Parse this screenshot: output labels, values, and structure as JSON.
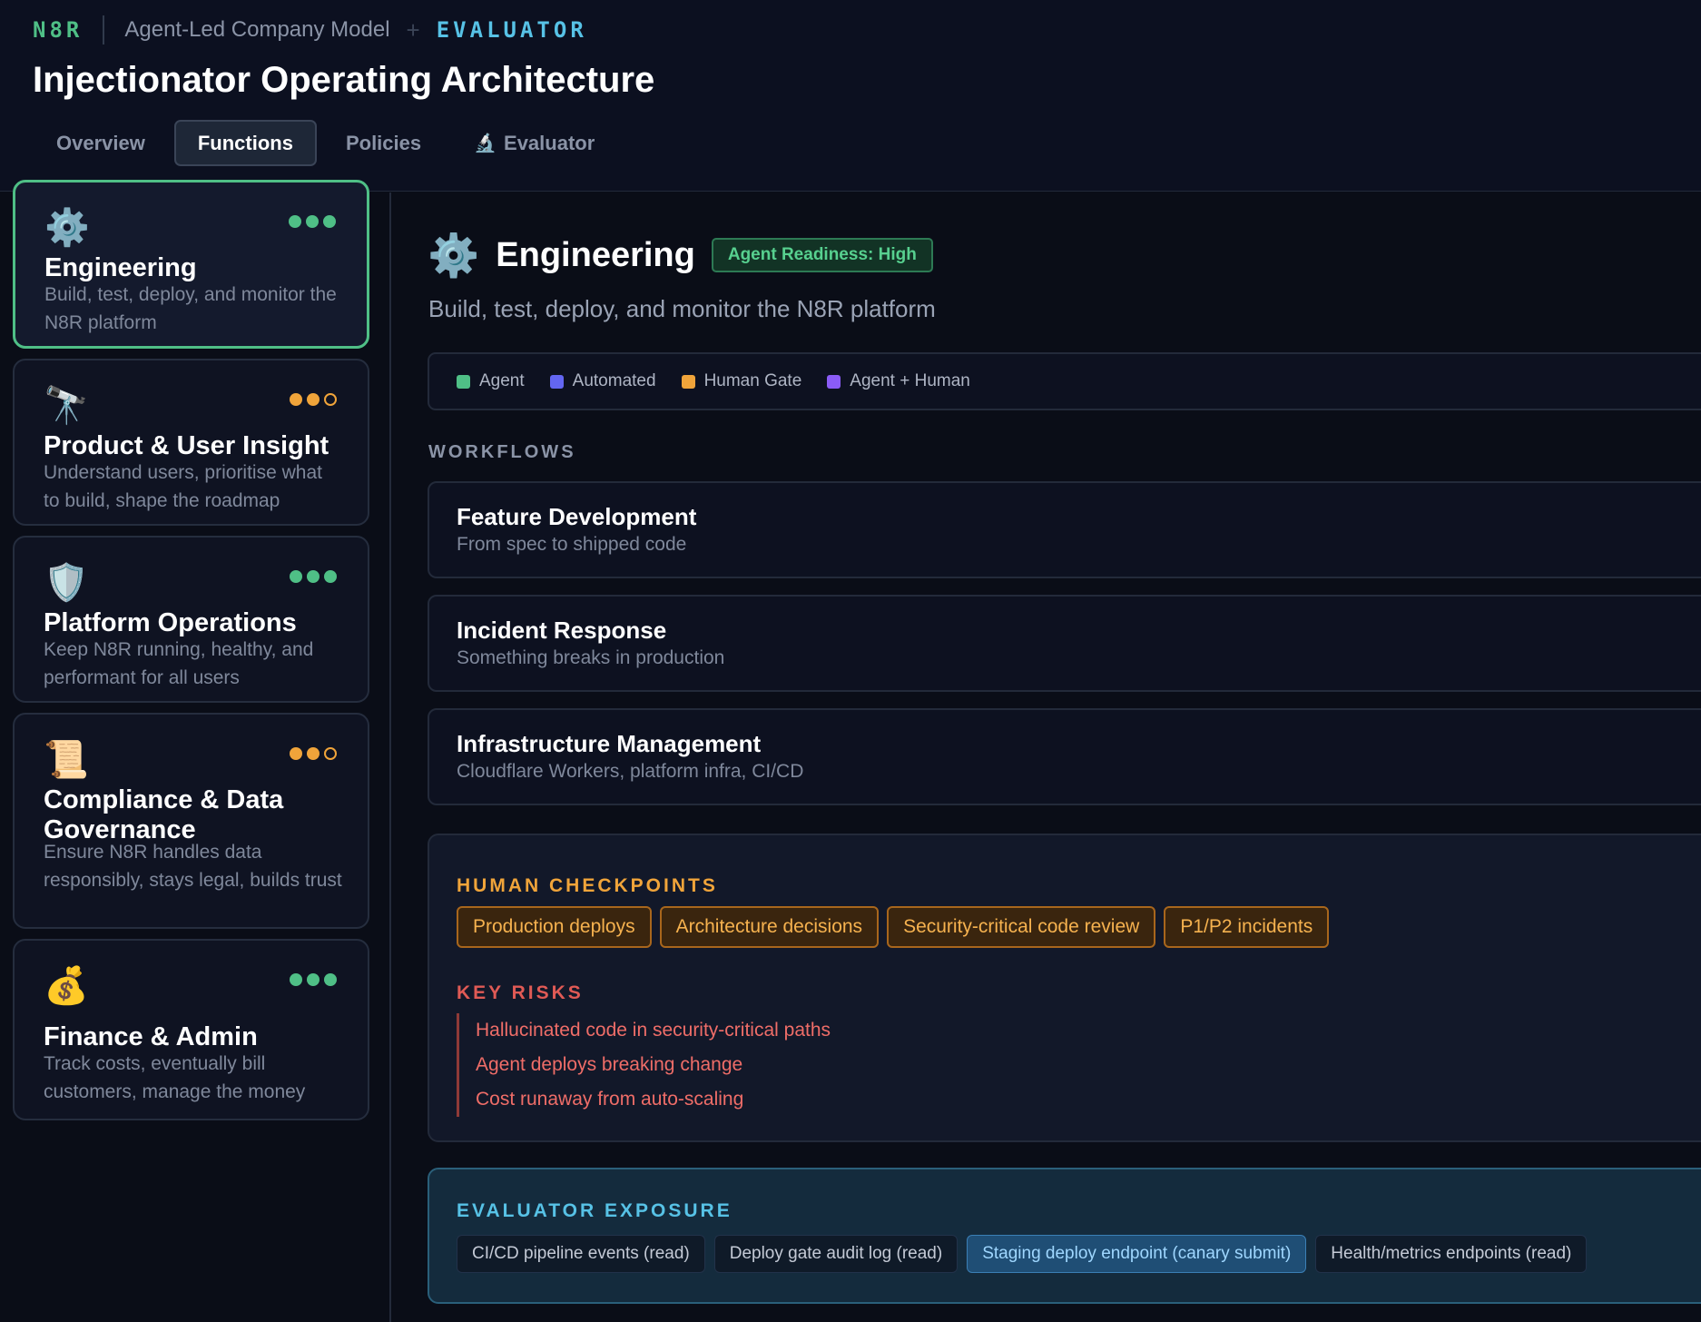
{
  "header": {
    "brand": "N8R",
    "breadcrumb": "Agent-Led Company Model",
    "separator": "+",
    "evaluator_tag": "EVALUATOR",
    "title": "Injectionator Operating Architecture",
    "tabs": [
      {
        "label": "Overview",
        "active": false
      },
      {
        "label": "Functions",
        "active": true
      },
      {
        "label": "Policies",
        "active": false
      },
      {
        "label": "Evaluator",
        "icon": "microscope-icon",
        "active": false
      }
    ]
  },
  "sidebar": {
    "functions": [
      {
        "icon": "gear-icon",
        "glyph": "⚙️",
        "name": "Engineering",
        "desc": "Build, test, deploy, and monitor the N8R platform",
        "readiness_dots": [
          "green",
          "green",
          "green"
        ],
        "active": true
      },
      {
        "icon": "telescope-icon",
        "glyph": "🔭",
        "name": "Product & User Insight",
        "desc": "Understand users, prioritise what to build, shape the roadmap",
        "readiness_dots": [
          "orange",
          "orange",
          "orange-empty"
        ],
        "active": false
      },
      {
        "icon": "shield-icon",
        "glyph": "🛡️",
        "name": "Platform Operations",
        "desc": "Keep N8R running, healthy, and performant for all users",
        "readiness_dots": [
          "green",
          "green",
          "green"
        ],
        "active": false
      },
      {
        "icon": "scroll-icon",
        "glyph": "📜",
        "name": "Compliance & Data Governance",
        "desc": "Ensure N8R handles data responsibly, stays legal, builds trust",
        "readiness_dots": [
          "orange",
          "orange",
          "orange-empty"
        ],
        "active": false
      },
      {
        "icon": "money-bag-icon",
        "glyph": "💰",
        "name": "Finance & Admin",
        "desc": "Track costs, eventually bill customers, manage the money",
        "readiness_dots": [
          "green",
          "green",
          "green"
        ],
        "active": false
      }
    ]
  },
  "main": {
    "icon": "gear-icon",
    "glyph": "⚙️",
    "title": "Engineering",
    "readiness_badge": "Agent Readiness: High",
    "description": "Build, test, deploy, and monitor the N8R platform",
    "legend": [
      {
        "label": "Agent",
        "color": "#4fbf86"
      },
      {
        "label": "Automated",
        "color": "#6366f1"
      },
      {
        "label": "Human Gate",
        "color": "#f0a43a"
      },
      {
        "label": "Agent + Human",
        "color": "#8b5cf6"
      }
    ],
    "workflows_label": "WORKFLOWS",
    "workflows": [
      {
        "title": "Feature Development",
        "subtitle": "From spec to shipped code"
      },
      {
        "title": "Incident Response",
        "subtitle": "Something breaks in production"
      },
      {
        "title": "Infrastructure Management",
        "subtitle": "Cloudflare Workers, platform infra, CI/CD"
      }
    ],
    "human_checkpoints_label": "HUMAN CHECKPOINTS",
    "human_checkpoints": [
      "Production deploys",
      "Architecture decisions",
      "Security-critical code review",
      "P1/P2 incidents"
    ],
    "key_risks_label": "KEY RISKS",
    "key_risks": [
      "Hallucinated code in security-critical paths",
      "Agent deploys breaking change",
      "Cost runaway from auto-scaling"
    ],
    "evaluator_exposure_label": "EVALUATOR EXPOSURE",
    "evaluator_exposure": [
      {
        "label": "CI/CD pipeline events (read)",
        "highlight": false
      },
      {
        "label": "Deploy gate audit log (read)",
        "highlight": false
      },
      {
        "label": "Staging deploy endpoint (canary submit)",
        "highlight": true
      },
      {
        "label": "Health/metrics endpoints (read)",
        "highlight": false
      }
    ]
  },
  "colors": {
    "accent_green": "#4fbf86",
    "accent_cyan": "#57c2e6",
    "human_gate_orange": "#f0a43a",
    "risk_red": "#ef6d68"
  }
}
